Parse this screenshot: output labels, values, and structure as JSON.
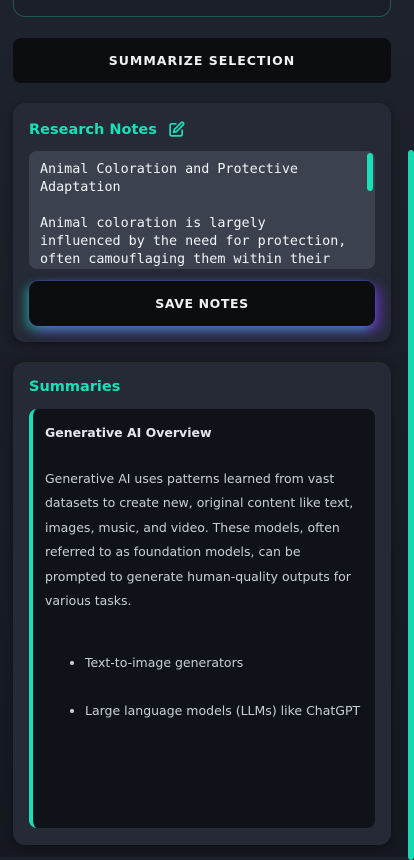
{
  "toolbar": {
    "summarize_label": "SUMMARIZE SELECTION"
  },
  "notes": {
    "title": "Research Notes",
    "edit_icon": "edit-icon",
    "text": "Animal Coloration and Protective\nAdaptation\n\nAnimal coloration is largely\ninfluenced by the need for protection,\noften camouflaging them within their",
    "save_label": "SAVE NOTES"
  },
  "summaries": {
    "title": "Summaries",
    "items": [
      {
        "title": "Generative AI Overview",
        "body": "Generative AI uses patterns learned from vast datasets to create new, original content like text, images, music, and video. These models, often referred to as foundation models, can be prompted to generate human-quality outputs for various tasks.",
        "bullets": [
          "Text-to-image generators",
          "Large language models (LLMs) like ChatGPT"
        ]
      }
    ]
  },
  "colors": {
    "accent": "#19e0b8",
    "background": "#1e222d",
    "card": "#252a36",
    "button": "#0c0d10",
    "glow_purple": "#7832e6"
  }
}
